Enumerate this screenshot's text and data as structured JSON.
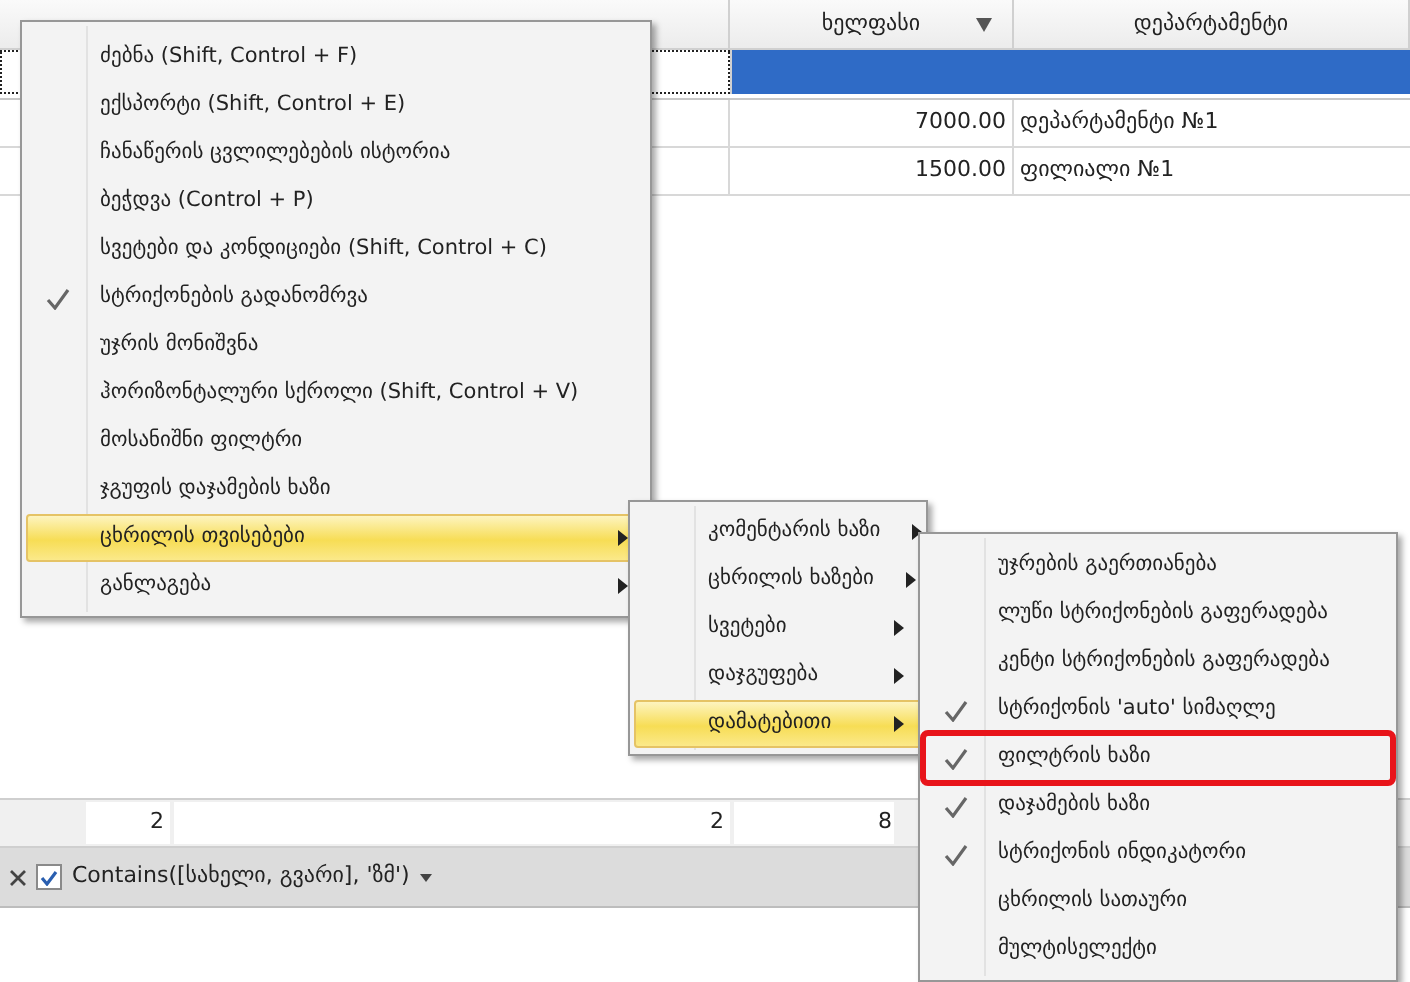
{
  "grid": {
    "columns": [
      {
        "label": "ხელფასი",
        "sorted": true
      },
      {
        "label": "დეპარტამენტი",
        "sorted": false
      }
    ],
    "rows": [
      [
        "7000.00",
        "დეპარტამენტი №1"
      ],
      [
        "1500.00",
        "ფილიალი №1"
      ]
    ],
    "summary": [
      "2",
      "2",
      "8"
    ],
    "filter_bar": {
      "enabled": true,
      "expression": "Contains([სახელი, გვარი], 'ზმ')"
    }
  },
  "context_menu": {
    "items": [
      {
        "label": "ძებნა (Shift, Control + F)",
        "checked": false,
        "has_submenu": false,
        "selected": false
      },
      {
        "label": "ექსპორტი (Shift, Control + E)",
        "checked": false,
        "has_submenu": false,
        "selected": false
      },
      {
        "label": "ჩანაწერის ცვლილებების ისტორია",
        "checked": false,
        "has_submenu": false,
        "selected": false
      },
      {
        "label": "ბეჭდვა (Control + P)",
        "checked": false,
        "has_submenu": false,
        "selected": false
      },
      {
        "label": "სვეტები და კონდიციები (Shift, Control + C)",
        "checked": false,
        "has_submenu": false,
        "selected": false
      },
      {
        "label": "სტრიქონების გადანომრვა",
        "checked": true,
        "has_submenu": false,
        "selected": false
      },
      {
        "label": "უჯრის  მონიშვნა",
        "checked": false,
        "has_submenu": false,
        "selected": false
      },
      {
        "label": "ჰორიზონტალური სქროლი (Shift, Control + V)",
        "checked": false,
        "has_submenu": false,
        "selected": false
      },
      {
        "label": "მოსანიშნი ფილტრი",
        "checked": false,
        "has_submenu": false,
        "selected": false
      },
      {
        "label": "ჯგუფის დაჯამების ხაზი",
        "checked": false,
        "has_submenu": false,
        "selected": false
      },
      {
        "label": "ცხრილის თვისებები",
        "checked": false,
        "has_submenu": true,
        "selected": true
      },
      {
        "label": "განლაგება",
        "checked": false,
        "has_submenu": true,
        "selected": false
      }
    ]
  },
  "submenu": {
    "items": [
      {
        "label": "კომენტარის ხაზი",
        "has_submenu": true,
        "selected": false
      },
      {
        "label": "ცხრილის ხაზები",
        "has_submenu": true,
        "selected": false
      },
      {
        "label": "სვეტები",
        "has_submenu": true,
        "selected": false
      },
      {
        "label": "დაჯგუფება",
        "has_submenu": true,
        "selected": false
      },
      {
        "label": "დამატებითი",
        "has_submenu": true,
        "selected": true
      }
    ]
  },
  "submenu_2": {
    "items": [
      {
        "label": "უჯრების გაერთიანება",
        "checked": false,
        "annotated": false
      },
      {
        "label": "ლუწი სტრიქონების გაფერადება",
        "checked": false,
        "annotated": false
      },
      {
        "label": "კენტი სტრიქონების გაფერადება",
        "checked": false,
        "annotated": false
      },
      {
        "label": "სტრიქონის 'auto' სიმაღლე",
        "checked": true,
        "annotated": false
      },
      {
        "label": "ფილტრის ხაზი",
        "checked": true,
        "annotated": true
      },
      {
        "label": "დაჯამების ხაზი",
        "checked": true,
        "annotated": false
      },
      {
        "label": "სტრიქონის ინდიკატორი",
        "checked": true,
        "annotated": false
      },
      {
        "label": "ცხრილის სათაური",
        "checked": false,
        "annotated": false
      },
      {
        "label": "მულტისელექტი",
        "checked": false,
        "annotated": false
      }
    ]
  }
}
